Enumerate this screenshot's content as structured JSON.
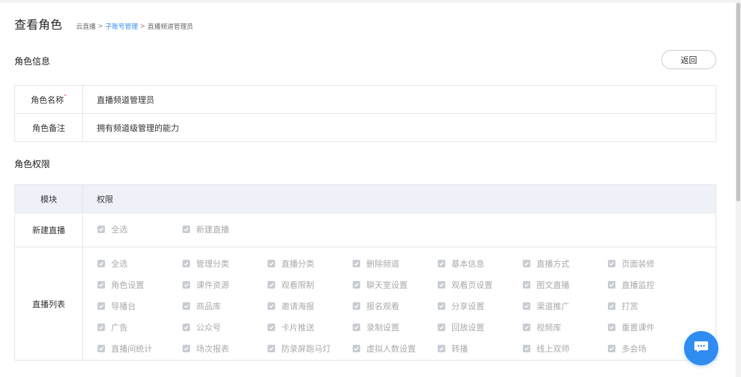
{
  "page_title": "查看角色",
  "breadcrumb": {
    "item1": "云直播",
    "item2": "子账号管理",
    "item3": "直播频道管理员",
    "sep": ">"
  },
  "role_info": {
    "section_title": "角色信息",
    "back_label": "返回",
    "name_label": "角色名称",
    "required_mark": "*",
    "name_value": "直播频道管理员",
    "note_label": "角色备注",
    "note_value": "拥有频道级管理的能力"
  },
  "permissions": {
    "section_title": "角色权限",
    "col_module": "模块",
    "col_permission": "权限",
    "rows": [
      {
        "module": "新建直播",
        "items": [
          "全选",
          "新建直播"
        ]
      },
      {
        "module": "直播列表",
        "items": [
          "全选",
          "管理分类",
          "直播分类",
          "删除频道",
          "基本信息",
          "直播方式",
          "页面装修",
          "角色设置",
          "课件资源",
          "观看限制",
          "聊天室设置",
          "观看页设置",
          "图文直播",
          "直播监控",
          "导播台",
          "商品库",
          "邀请海报",
          "报名观看",
          "分享设置",
          "渠道推广",
          "打赏",
          "广告",
          "公众号",
          "卡片推送",
          "录制设置",
          "回放设置",
          "视频库",
          "重置课件",
          "直播间统计",
          "场次报表",
          "防录屏跑马灯",
          "虚拟人数设置",
          "转播",
          "线上双师",
          "多会场"
        ]
      }
    ]
  },
  "icons": {
    "checkbox": "checkbox-checked-icon",
    "chat": "chat-bubble-icon"
  },
  "colors": {
    "accent": "#2f8cf0",
    "required": "#f56c6c",
    "header_bg": "#eef1f8",
    "disabled_text": "#aaaaaa"
  }
}
